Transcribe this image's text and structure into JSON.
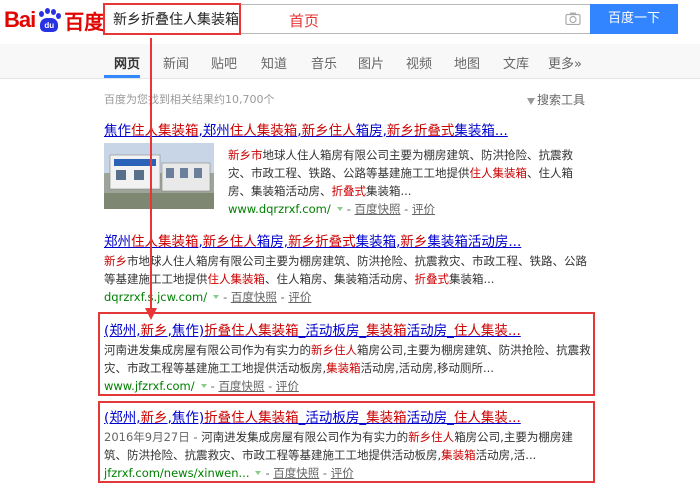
{
  "brand": {
    "logo_left": "Bai",
    "logo_paw": "du",
    "logo_right": "百度"
  },
  "search": {
    "query": "新乡折叠住人集装箱",
    "button": "百度一下"
  },
  "annotation": "首页",
  "tabs": [
    "网页",
    "新闻",
    "贴吧",
    "知道",
    "音乐",
    "图片",
    "视频",
    "地图",
    "文库",
    "更多»"
  ],
  "active_tab": "网页",
  "result_count": "百度为您找到相关结果约10,700个",
  "search_tools": "搜索工具",
  "results": [
    {
      "title_parts": [
        "焦作",
        "住人集装箱",
        ",郑州",
        "住人集装箱",
        ",",
        "新乡住人",
        "箱房,",
        "新乡折叠式",
        "集装箱..."
      ],
      "abstract": [
        "新乡市",
        "地球人住人箱房有限公司主要为棚房建筑、防洪抢险、抗震救灾、市政工程、铁路、公路等基建施工工地提供",
        "住人集装箱",
        "、住人箱房、集装箱活动房、",
        "折叠式",
        "集装箱..."
      ],
      "url": "www.dqrzrxf.com/",
      "snapshot": "百度快照",
      "review": "评价"
    },
    {
      "title_parts": [
        "郑州",
        "住人集装箱",
        ",",
        "新乡住人",
        "箱房,",
        "新乡折叠式",
        "集装箱,",
        "新乡",
        "集装箱活动房..."
      ],
      "abstract": [
        "新乡",
        "市地球人住人箱房有限公司主要为棚房建筑、防洪抢险、抗震救灾、市政工程、铁路、公路等基建施工工地提供",
        "住人集装箱",
        "、住人箱房、集装箱活动房、",
        "折叠式",
        "集装箱..."
      ],
      "url": "dqrzrxf.s.jcw.com/",
      "snapshot": "百度快照",
      "review": "评价"
    },
    {
      "title_parts": [
        "(郑州,",
        "新乡",
        ",焦作)",
        "折叠住人集装箱",
        "_活动板房_",
        "集装箱",
        "活动房_",
        "住人集装..."
      ],
      "abstract": [
        "河南进发集成房屋有限公司作为有实力的",
        "新乡住人",
        "箱房公司,主要为棚房建筑、防洪抢险、抗震救灾、市政工程等基建施工工地提供活动板房,",
        "集装箱",
        "活动房,活动房,移动厕所..."
      ],
      "url": "www.jfzrxf.com/",
      "snapshot": "百度快照",
      "review": "评价"
    },
    {
      "title_parts": [
        "(郑州,",
        "新乡",
        ",焦作)",
        "折叠住人集装箱",
        "_活动板房_",
        "集装箱",
        "活动房_",
        "住人集装..."
      ],
      "date": "2016年9月27日 - ",
      "abstract": [
        "河南进发集成房屋有限公司作为有实力的",
        "新乡住人",
        "箱房公司,主要为棚房建筑、防洪抢险、抗震救灾、市政工程等基建施工工地提供活动板房,",
        "集装箱",
        "活动房,活..."
      ],
      "url": "jfzrxf.com/news/xinwen...",
      "snapshot": "百度快照",
      "review": "评价"
    }
  ],
  "colors": {
    "link": "#0000cc",
    "highlight": "#cc0000",
    "url": "#008000",
    "annotation": "#e83535",
    "button": "#3385ff"
  }
}
